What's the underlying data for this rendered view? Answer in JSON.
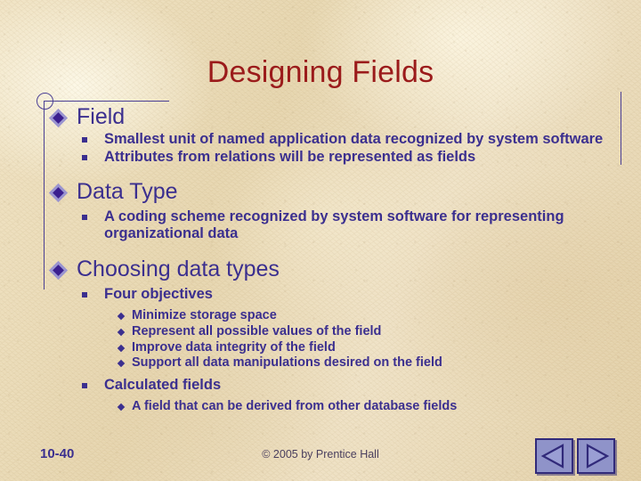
{
  "slide": {
    "title": "Designing Fields",
    "title_color": "#9b1b1b",
    "text_color": "#3b2f8f",
    "background_color": "#e8d9b5",
    "sections": [
      {
        "heading": "Field",
        "bullets": [
          "Smallest unit of named application data recognized by system software",
          "Attributes from relations will be represented as fields"
        ]
      },
      {
        "heading": "Data Type",
        "bullets": [
          "A coding scheme recognized by system software for representing organizational data"
        ]
      },
      {
        "heading": "Choosing data types",
        "bullets": [
          "Four objectives",
          "Calculated fields"
        ],
        "sub_bullets_a": [
          "Minimize storage space",
          "Represent all possible values of the field",
          "Improve data integrity of the field",
          "Support all data manipulations desired on the field"
        ],
        "sub_bullets_b": [
          "A field that can be derived from other database fields"
        ]
      }
    ]
  },
  "footer": {
    "slide_number": "10-40",
    "copyright": "© 2005 by Prentice Hall"
  },
  "nav": {
    "prev_label": "Previous slide",
    "next_label": "Next slide"
  }
}
